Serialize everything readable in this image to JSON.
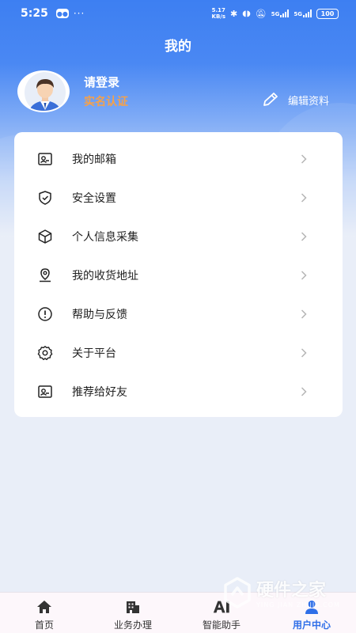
{
  "status_bar": {
    "time": "5:25",
    "net_speed_value": "5.17",
    "net_speed_unit": "KB/s",
    "signal_1_label": "5G",
    "signal_2_label": "5G",
    "battery": "100"
  },
  "header": {
    "title": "我的"
  },
  "profile": {
    "login_prompt": "请登录",
    "verify_label": "实名认证",
    "edit_label": "编辑资料"
  },
  "menu": {
    "items": [
      {
        "label": "我的邮箱",
        "icon": "mailbox-icon"
      },
      {
        "label": "安全设置",
        "icon": "shield-check-icon"
      },
      {
        "label": "个人信息采集",
        "icon": "box-icon"
      },
      {
        "label": "我的收货地址",
        "icon": "location-pin-icon"
      },
      {
        "label": "帮助与反馈",
        "icon": "exclamation-circle-icon"
      },
      {
        "label": "关于平台",
        "icon": "gear-icon"
      },
      {
        "label": "推荐给好友",
        "icon": "user-card-icon"
      }
    ]
  },
  "tab_bar": {
    "tabs": [
      {
        "label": "首页",
        "icon": "home-icon",
        "active": false
      },
      {
        "label": "业务办理",
        "icon": "building-icon",
        "active": false
      },
      {
        "label": "智能助手",
        "icon": "ai-icon",
        "active": false
      },
      {
        "label": "用户中心",
        "icon": "user-icon",
        "active": true
      }
    ]
  },
  "watermark": {
    "title": "硬件之家",
    "subtitle": "YING JIAN ZHIJIA.COM"
  },
  "colors": {
    "primary": "#3d7ff2",
    "verify": "#f5a14a",
    "active_tab": "#2f6fe8",
    "background": "#e9eef8"
  }
}
